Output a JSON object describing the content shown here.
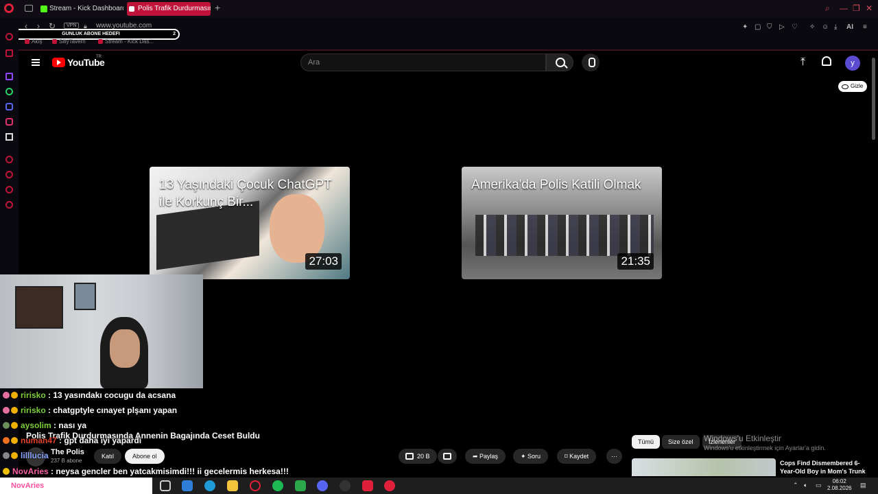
{
  "browser": {
    "tabs": [
      {
        "label": "Stream - Kick Dashboard",
        "active": false
      },
      {
        "label": "Polis Trafik Durdurmasında",
        "active": true
      }
    ],
    "address": {
      "vpn_label": "VPN",
      "url": "www.youtube.com"
    },
    "bookmarks": [
      "Akış",
      "SillyTavern",
      "Stream - Kick Das..."
    ],
    "ai_label": "AI"
  },
  "overlay_goal": {
    "label": "GUNLUK ABONE HEDEFI",
    "current": "0",
    "target": "2"
  },
  "youtube": {
    "logo_text": "YouTube",
    "country_code": "TR",
    "search_placeholder": "Ara",
    "avatar_letter": "y",
    "hide_label": "Gizle"
  },
  "endscreen_cards": [
    {
      "title": "13 Yaşındaki Çocuk ChatGPT ile Korkunç Bir...",
      "duration": "27:03"
    },
    {
      "title": "Amerika'da Polis Katili Olmak",
      "duration": "21:35"
    }
  ],
  "chat": [
    {
      "user": "ririsko",
      "message": ": 13 yasındakı cocugu da acsana"
    },
    {
      "user": "ririsko",
      "message": ": chatgptyle cınayet plşanı yapan"
    },
    {
      "user": "aysolim",
      "message": ": nası ya"
    },
    {
      "user": "numan47",
      "message": ": gpt daha iyi yapardı"
    },
    {
      "user": "lilllucia",
      "message": ""
    },
    {
      "user": "NovAries",
      "message": ": neysa gencler ben yatcakmisimdi!!! ii gecelermis herkesa!!!"
    }
  ],
  "video": {
    "title": "Polis Trafik Durdurmasında Annenin Bagajında Ceset Buldu",
    "channel": "The Polis",
    "subscribers": "237 B abone",
    "join_label": "Katıl",
    "subscribe_label": "Abone ol",
    "likes": "20 B",
    "share_label": "Paylaş",
    "ask_label": "Soru",
    "save_label": "Kaydet"
  },
  "filter_chips": [
    "Tümü",
    "Size özel",
    "İzlenenler"
  ],
  "windows_activation": {
    "title": "Windows'u Etkinleştir",
    "subtitle": "Windows'u etkinleştirmek için Ayarlar'a gidin."
  },
  "recommendation": {
    "title": "Cops Find Dismembered 6-Year-Old Boy in Mom's Trunk"
  },
  "taskbar": {
    "time": "06:02",
    "date": "2.08.2026",
    "search_text": "NovAries"
  }
}
